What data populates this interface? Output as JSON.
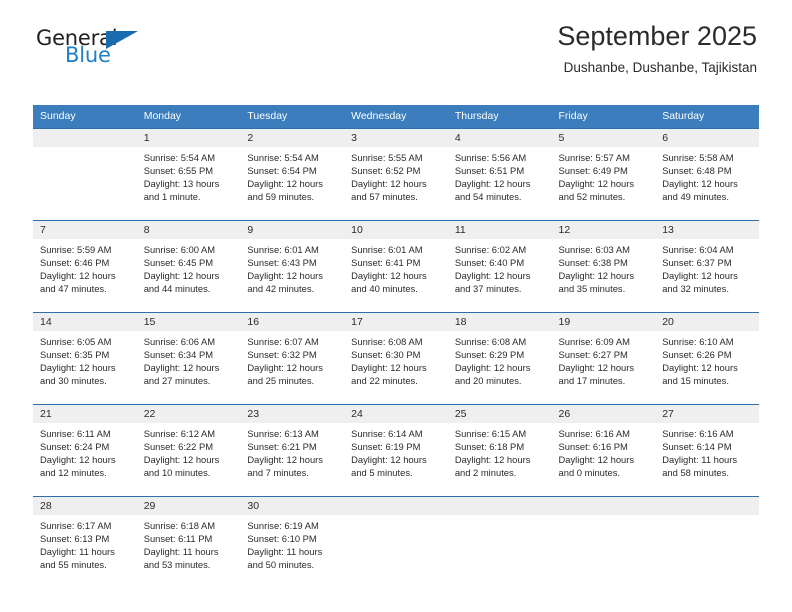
{
  "brand": {
    "name_top": "General",
    "name_bottom": "Blue",
    "triangle_icon": "triangle-icon",
    "color_dark": "#231f20",
    "color_blue": "#1f7fc4"
  },
  "header": {
    "title": "September 2025",
    "subtitle": "Dushanbe, Dushanbe, Tajikistan"
  },
  "theme": {
    "header_bg": "#3b7dbd",
    "row_divider": "#2f6ea8",
    "daynum_band": "#efefef",
    "text": "#2b2b2b"
  },
  "calendar": {
    "columns": [
      "Sunday",
      "Monday",
      "Tuesday",
      "Wednesday",
      "Thursday",
      "Friday",
      "Saturday"
    ],
    "weeks": [
      [
        {
          "day": "",
          "lines": []
        },
        {
          "day": "1",
          "lines": [
            "Sunrise: 5:54 AM",
            "Sunset: 6:55 PM",
            "Daylight: 13 hours",
            "and 1 minute."
          ]
        },
        {
          "day": "2",
          "lines": [
            "Sunrise: 5:54 AM",
            "Sunset: 6:54 PM",
            "Daylight: 12 hours",
            "and 59 minutes."
          ]
        },
        {
          "day": "3",
          "lines": [
            "Sunrise: 5:55 AM",
            "Sunset: 6:52 PM",
            "Daylight: 12 hours",
            "and 57 minutes."
          ]
        },
        {
          "day": "4",
          "lines": [
            "Sunrise: 5:56 AM",
            "Sunset: 6:51 PM",
            "Daylight: 12 hours",
            "and 54 minutes."
          ]
        },
        {
          "day": "5",
          "lines": [
            "Sunrise: 5:57 AM",
            "Sunset: 6:49 PM",
            "Daylight: 12 hours",
            "and 52 minutes."
          ]
        },
        {
          "day": "6",
          "lines": [
            "Sunrise: 5:58 AM",
            "Sunset: 6:48 PM",
            "Daylight: 12 hours",
            "and 49 minutes."
          ]
        }
      ],
      [
        {
          "day": "7",
          "lines": [
            "Sunrise: 5:59 AM",
            "Sunset: 6:46 PM",
            "Daylight: 12 hours",
            "and 47 minutes."
          ]
        },
        {
          "day": "8",
          "lines": [
            "Sunrise: 6:00 AM",
            "Sunset: 6:45 PM",
            "Daylight: 12 hours",
            "and 44 minutes."
          ]
        },
        {
          "day": "9",
          "lines": [
            "Sunrise: 6:01 AM",
            "Sunset: 6:43 PM",
            "Daylight: 12 hours",
            "and 42 minutes."
          ]
        },
        {
          "day": "10",
          "lines": [
            "Sunrise: 6:01 AM",
            "Sunset: 6:41 PM",
            "Daylight: 12 hours",
            "and 40 minutes."
          ]
        },
        {
          "day": "11",
          "lines": [
            "Sunrise: 6:02 AM",
            "Sunset: 6:40 PM",
            "Daylight: 12 hours",
            "and 37 minutes."
          ]
        },
        {
          "day": "12",
          "lines": [
            "Sunrise: 6:03 AM",
            "Sunset: 6:38 PM",
            "Daylight: 12 hours",
            "and 35 minutes."
          ]
        },
        {
          "day": "13",
          "lines": [
            "Sunrise: 6:04 AM",
            "Sunset: 6:37 PM",
            "Daylight: 12 hours",
            "and 32 minutes."
          ]
        }
      ],
      [
        {
          "day": "14",
          "lines": [
            "Sunrise: 6:05 AM",
            "Sunset: 6:35 PM",
            "Daylight: 12 hours",
            "and 30 minutes."
          ]
        },
        {
          "day": "15",
          "lines": [
            "Sunrise: 6:06 AM",
            "Sunset: 6:34 PM",
            "Daylight: 12 hours",
            "and 27 minutes."
          ]
        },
        {
          "day": "16",
          "lines": [
            "Sunrise: 6:07 AM",
            "Sunset: 6:32 PM",
            "Daylight: 12 hours",
            "and 25 minutes."
          ]
        },
        {
          "day": "17",
          "lines": [
            "Sunrise: 6:08 AM",
            "Sunset: 6:30 PM",
            "Daylight: 12 hours",
            "and 22 minutes."
          ]
        },
        {
          "day": "18",
          "lines": [
            "Sunrise: 6:08 AM",
            "Sunset: 6:29 PM",
            "Daylight: 12 hours",
            "and 20 minutes."
          ]
        },
        {
          "day": "19",
          "lines": [
            "Sunrise: 6:09 AM",
            "Sunset: 6:27 PM",
            "Daylight: 12 hours",
            "and 17 minutes."
          ]
        },
        {
          "day": "20",
          "lines": [
            "Sunrise: 6:10 AM",
            "Sunset: 6:26 PM",
            "Daylight: 12 hours",
            "and 15 minutes."
          ]
        }
      ],
      [
        {
          "day": "21",
          "lines": [
            "Sunrise: 6:11 AM",
            "Sunset: 6:24 PM",
            "Daylight: 12 hours",
            "and 12 minutes."
          ]
        },
        {
          "day": "22",
          "lines": [
            "Sunrise: 6:12 AM",
            "Sunset: 6:22 PM",
            "Daylight: 12 hours",
            "and 10 minutes."
          ]
        },
        {
          "day": "23",
          "lines": [
            "Sunrise: 6:13 AM",
            "Sunset: 6:21 PM",
            "Daylight: 12 hours",
            "and 7 minutes."
          ]
        },
        {
          "day": "24",
          "lines": [
            "Sunrise: 6:14 AM",
            "Sunset: 6:19 PM",
            "Daylight: 12 hours",
            "and 5 minutes."
          ]
        },
        {
          "day": "25",
          "lines": [
            "Sunrise: 6:15 AM",
            "Sunset: 6:18 PM",
            "Daylight: 12 hours",
            "and 2 minutes."
          ]
        },
        {
          "day": "26",
          "lines": [
            "Sunrise: 6:16 AM",
            "Sunset: 6:16 PM",
            "Daylight: 12 hours",
            "and 0 minutes."
          ]
        },
        {
          "day": "27",
          "lines": [
            "Sunrise: 6:16 AM",
            "Sunset: 6:14 PM",
            "Daylight: 11 hours",
            "and 58 minutes."
          ]
        }
      ],
      [
        {
          "day": "28",
          "lines": [
            "Sunrise: 6:17 AM",
            "Sunset: 6:13 PM",
            "Daylight: 11 hours",
            "and 55 minutes."
          ]
        },
        {
          "day": "29",
          "lines": [
            "Sunrise: 6:18 AM",
            "Sunset: 6:11 PM",
            "Daylight: 11 hours",
            "and 53 minutes."
          ]
        },
        {
          "day": "30",
          "lines": [
            "Sunrise: 6:19 AM",
            "Sunset: 6:10 PM",
            "Daylight: 11 hours",
            "and 50 minutes."
          ]
        },
        {
          "day": "",
          "lines": []
        },
        {
          "day": "",
          "lines": []
        },
        {
          "day": "",
          "lines": []
        },
        {
          "day": "",
          "lines": []
        }
      ]
    ]
  }
}
